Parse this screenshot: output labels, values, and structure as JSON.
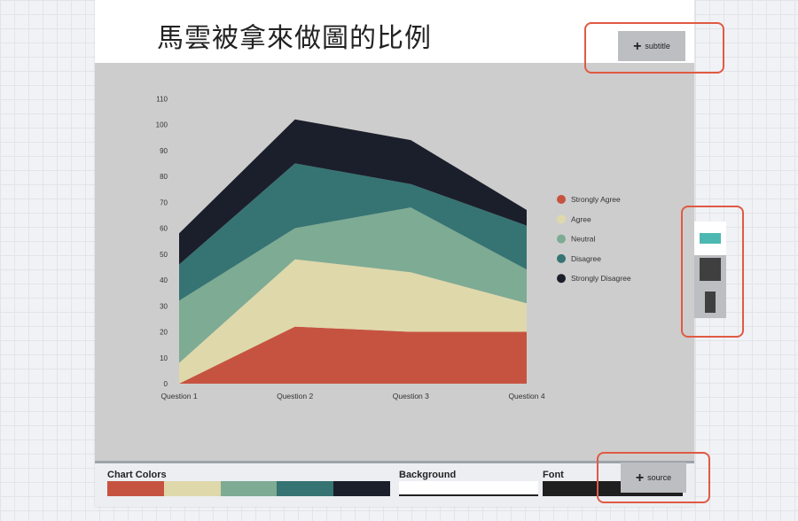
{
  "title": "馬雲被拿來做圖的比例",
  "subtitle_button": "subtitle",
  "source_button": "source",
  "panel": {
    "chart_colors_label": "Chart Colors",
    "background_label": "Background",
    "font_label": "Font",
    "palette": [
      "#c65340",
      "#dfd8ab",
      "#7eab93",
      "#367473",
      "#1b1f2b"
    ],
    "background_color": "#ffffff",
    "font_color": "#1f1f1f"
  },
  "side_panel": {
    "icons": [
      "color-swatch-icon",
      "square-icon",
      "bar-icon"
    ],
    "accent_color": "#4db8b2"
  },
  "chart_data": {
    "type": "area",
    "stacked": true,
    "title": "馬雲被拿來做圖的比例",
    "categories": [
      "Question 1",
      "Question 2",
      "Question 3",
      "Question 4"
    ],
    "y_ticks": [
      "0",
      "10",
      "20",
      "30",
      "40",
      "50",
      "60",
      "70",
      "80",
      "90",
      "100",
      "110"
    ],
    "ylim": [
      0,
      110
    ],
    "series": [
      {
        "name": "Strongly Agree",
        "color": "#c65340",
        "values": [
          0,
          22,
          20,
          20
        ]
      },
      {
        "name": "Agree",
        "color": "#dfd8ab",
        "values": [
          8,
          26,
          23,
          11
        ]
      },
      {
        "name": "Neutral",
        "color": "#7eab93",
        "values": [
          24,
          12,
          25,
          13
        ]
      },
      {
        "name": "Disagree",
        "color": "#367473",
        "values": [
          14,
          25,
          9,
          17
        ]
      },
      {
        "name": "Strongly Disagree",
        "color": "#1b1f2b",
        "values": [
          12,
          17,
          17,
          6
        ]
      }
    ],
    "legend_position": "right",
    "grid": false
  }
}
